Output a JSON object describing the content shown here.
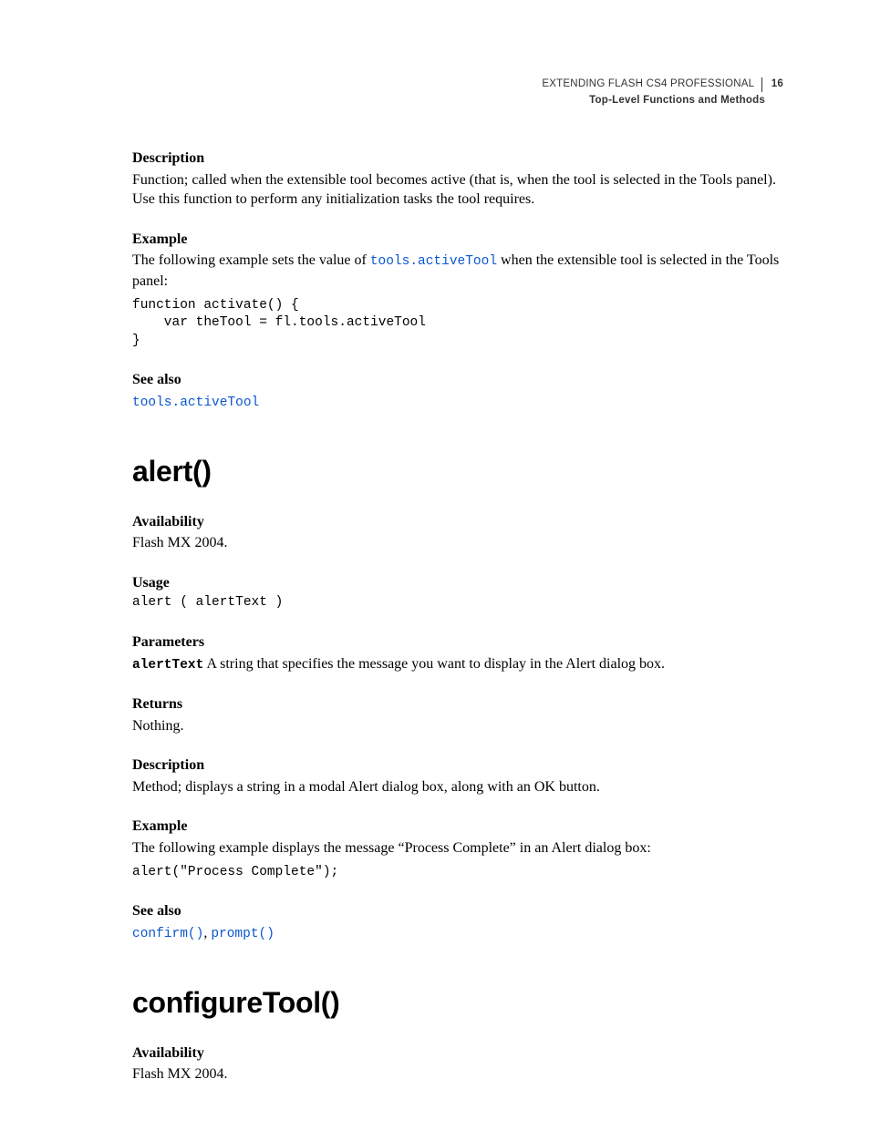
{
  "header": {
    "doc_title": "EXTENDING FLASH CS4 PROFESSIONAL",
    "page_number": "16",
    "section": "Top-Level Functions and Methods"
  },
  "section1": {
    "h_description": "Description",
    "description_body": "Function; called when the extensible tool becomes active (that is, when the tool is selected in the Tools panel). Use this function to perform any initialization tasks the tool requires.",
    "h_example": "Example",
    "example_intro_before": "The following example sets the value of ",
    "example_intro_code": "tools.activeTool",
    "example_intro_after": " when the extensible tool is selected in the Tools panel:",
    "example_code": "function activate() {\n    var theTool = fl.tools.activeTool\n}",
    "h_seealso": "See also",
    "seealso_link": "tools.activeTool"
  },
  "alert": {
    "title": "alert()",
    "h_availability": "Availability",
    "availability_body": "Flash MX 2004.",
    "h_usage": "Usage",
    "usage_code": "alert ( alertText )",
    "h_parameters": "Parameters",
    "param_name": "alertText",
    "param_body": "  A string that specifies the message you want to display in the Alert dialog box.",
    "h_returns": "Returns",
    "returns_body": "Nothing.",
    "h_description": "Description",
    "description_body": "Method; displays a string in a modal Alert dialog box, along with an OK button.",
    "h_example": "Example",
    "example_intro": "The following example displays the message “Process Complete” in an Alert dialog box:",
    "example_code": "alert(\"Process Complete\");",
    "h_seealso": "See also",
    "seealso_link1": "confirm()",
    "seealso_sep": ", ",
    "seealso_link2": "prompt()"
  },
  "configureTool": {
    "title": "configureTool()",
    "h_availability": "Availability",
    "availability_body": "Flash MX 2004."
  }
}
